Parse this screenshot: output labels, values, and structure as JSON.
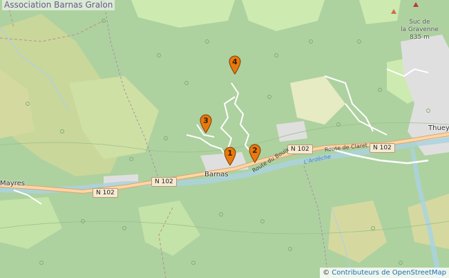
{
  "map": {
    "title": "Association Barnas Gralon",
    "attribution": {
      "symbol": "©",
      "link_text": "Contributeurs de OpenStreetMap"
    },
    "places": {
      "barnas": "Barnas",
      "mayres": "Mayres",
      "thueyts": "Thuey"
    },
    "peak": {
      "line1": "Suc de",
      "line2": "la Gravenne",
      "elevation": "835 m"
    },
    "road_shields": [
      "N 102",
      "N 102",
      "N 102",
      "N 102"
    ],
    "road_labels": {
      "route_du_bouix": "Route du Bouix",
      "route_de_claret": "Route de Claret"
    },
    "river_label": "L'Ardèche",
    "markers": [
      {
        "label": "1"
      },
      {
        "label": "2"
      },
      {
        "label": "3"
      },
      {
        "label": "4"
      }
    ],
    "colors": {
      "forest": "#aed1a0",
      "meadow": "#cdebb0",
      "farmland": "#eef0d5",
      "heath": "#d6d99f",
      "urban": "#e0dfdf",
      "water": "#aad3df",
      "primary_road": "#fcd6a4",
      "marker": "#e8790f"
    }
  }
}
